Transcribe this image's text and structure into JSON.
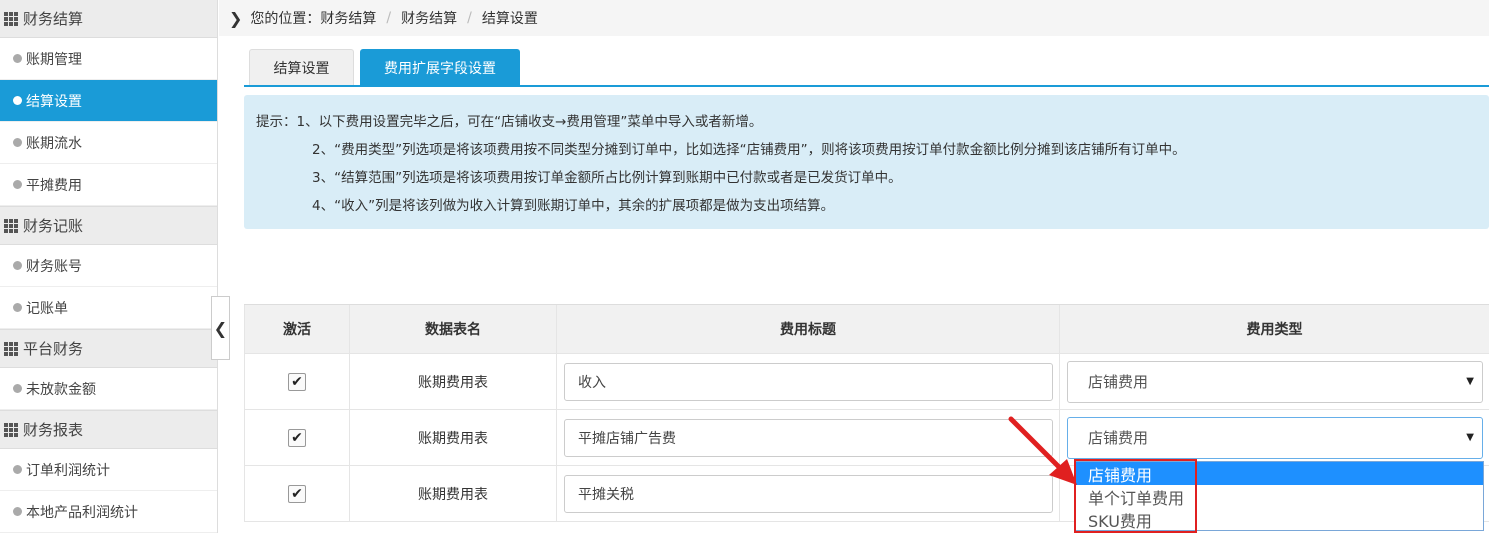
{
  "sidebar": {
    "groups": [
      {
        "title": "财务结算",
        "items": [
          "账期管理",
          "结算设置",
          "账期流水",
          "平摊费用"
        ]
      },
      {
        "title": "财务记账",
        "items": [
          "财务账号",
          "记账单"
        ]
      },
      {
        "title": "平台财务",
        "items": [
          "未放款金额"
        ]
      },
      {
        "title": "财务报表",
        "items": [
          "订单利润统计",
          "本地产品利润统计"
        ]
      }
    ],
    "active_item": "结算设置"
  },
  "breadcrumb": {
    "prefix": "您的位置：",
    "items": [
      "财务结算",
      "财务结算",
      "结算设置"
    ]
  },
  "tabs": [
    "结算设置",
    "费用扩展字段设置"
  ],
  "active_tab": "费用扩展字段设置",
  "tips": {
    "lines": [
      "提示：1、以下费用设置完毕之后，可在“店铺收支→费用管理”菜单中导入或者新增。",
      "2、“费用类型”列选项是将该项费用按不同类型分摊到订单中，比如选择“店铺费用”，则将该项费用按订单付款金额比例分摊到该店铺所有订单中。",
      "3、“结算范围”列选项是将该项费用按订单金额所占比例计算到账期中已付款或者是已发货订单中。",
      "4、“收入”列是将该列做为收入计算到账期订单中，其余的扩展项都是做为支出项结算。"
    ]
  },
  "table": {
    "headers": [
      "激活",
      "数据表名",
      "费用标题",
      "费用类型"
    ],
    "rows": [
      {
        "active": true,
        "table_name": "账期费用表",
        "title": "收入",
        "type": "店铺费用"
      },
      {
        "active": true,
        "table_name": "账期费用表",
        "title": "平摊店铺广告费",
        "type": "店铺费用"
      },
      {
        "active": true,
        "table_name": "账期费用表",
        "title": "平摊关税",
        "type": ""
      }
    ]
  },
  "dropdown": {
    "options": [
      "店铺费用",
      "单个订单费用",
      "SKU费用"
    ],
    "selected": "店铺费用"
  },
  "colors": {
    "accent": "#1a9bd7",
    "tip_bg": "#d9edf7",
    "annotation": "#e02020",
    "option_selected": "#1e90ff"
  }
}
